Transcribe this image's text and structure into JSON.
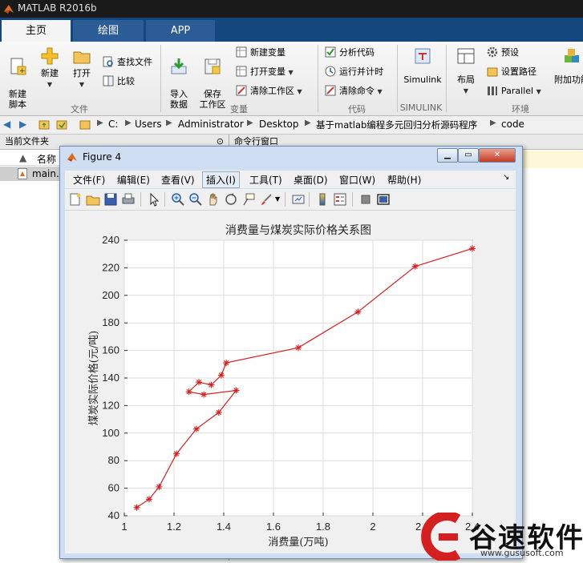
{
  "app": {
    "title": "MATLAB R2016b"
  },
  "tabs": [
    {
      "label": "主页"
    },
    {
      "label": "绘图"
    },
    {
      "label": "APP"
    }
  ],
  "ribbon": {
    "file_group": {
      "new_script": "新建\n脚本",
      "new": "新建",
      "open": "打开",
      "find_files": "查找文件",
      "compare": "比较",
      "label": "文件"
    },
    "variable_group": {
      "import": "导入\n数据",
      "save_ws": "保存\n工作区",
      "new_var": "新建变量",
      "open_var": "打开变量",
      "clear_ws": "清除工作区",
      "label": "变量"
    },
    "code_group": {
      "analyze": "分析代码",
      "run_time": "运行并计时",
      "clear_cmd": "清除命令",
      "label": "代码"
    },
    "simulink_group": {
      "simulink": "Simulink",
      "label": "SIMULINK"
    },
    "env_group": {
      "layout": "布局",
      "prefs": "预设",
      "set_path": "设置路径",
      "parallel": "Parallel",
      "addons": "附加功能",
      "label": "环境"
    }
  },
  "address": {
    "parts": [
      "C:",
      "Users",
      "Administrator",
      "Desktop",
      "基于matlab编程多元回归分析源码程序",
      "code"
    ]
  },
  "current_folder": {
    "header": "当前文件夹",
    "name_col": "名称",
    "file": "main.m"
  },
  "command_window": {
    "header": "命令行窗口"
  },
  "figure": {
    "title": "Figure 4",
    "menu": [
      "文件(F)",
      "编辑(E)",
      "查看(V)",
      "插入(I)",
      "工具(T)",
      "桌面(D)",
      "窗口(W)",
      "帮助(H)"
    ]
  },
  "colors": {
    "line": "#d62020",
    "ribbon_tab": "#15477f",
    "fig_frame": "#cfdff1"
  },
  "chart_data": {
    "type": "line",
    "title": "消费量与煤炭实际价格关系图",
    "xlabel": "消费量(万吨)",
    "ylabel": "煤炭实际价格(元/吨)",
    "xlim": [
      1,
      2.4
    ],
    "ylim": [
      40,
      240
    ],
    "xticks": [
      "1",
      "1.2",
      "1.4",
      "1.6",
      "1.8",
      "2",
      "2.2",
      "2.4"
    ],
    "yticks": [
      "40",
      "60",
      "80",
      "100",
      "120",
      "140",
      "160",
      "180",
      "200",
      "220",
      "240"
    ],
    "grid": true,
    "marker": "*",
    "series": [
      {
        "x": [
          1.05,
          1.1,
          1.14,
          1.21,
          1.29,
          1.38,
          1.45,
          1.32,
          1.26,
          1.3,
          1.35,
          1.39,
          1.41,
          1.7,
          1.94,
          2.17,
          2.4
        ],
        "y": [
          46,
          52,
          61,
          85,
          103,
          115,
          131,
          128,
          130,
          137,
          135,
          142,
          151,
          162,
          188,
          221,
          234
        ]
      }
    ]
  },
  "watermark": {
    "brand": "谷速软件",
    "url": "www.gususoft.com"
  }
}
